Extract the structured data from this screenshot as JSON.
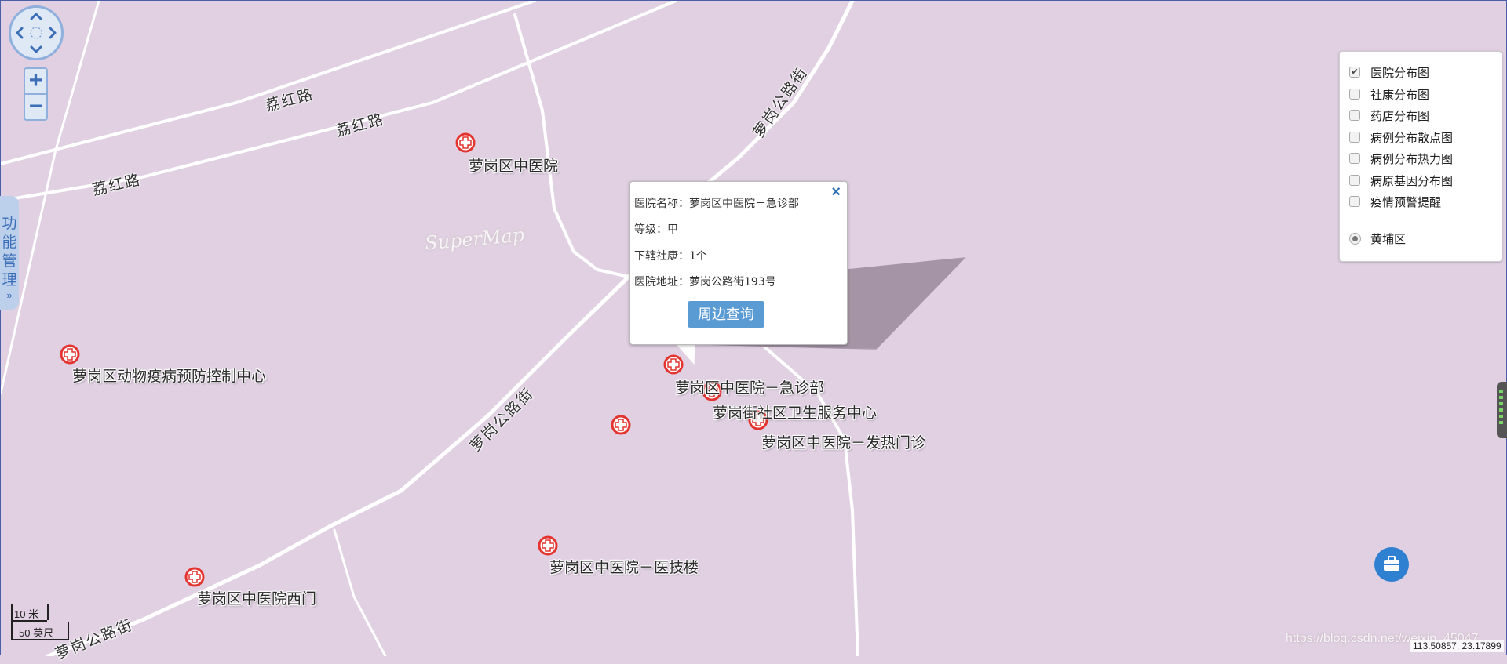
{
  "map": {
    "roads": [
      {
        "name": "荔红路"
      },
      {
        "name": "荔红路"
      },
      {
        "name": "荔红路"
      },
      {
        "name": "萝岗公路街"
      },
      {
        "name": "萝岗公路街"
      },
      {
        "name": "萝岗公路街"
      }
    ],
    "watermark": "SuperMap",
    "pois": [
      {
        "label": "萝岗区中医院"
      },
      {
        "label": "萝岗区动物疫病预防控制中心"
      },
      {
        "label": "萝岗区中医院－急诊部"
      },
      {
        "label": "萝岗街社区卫生服务中心"
      },
      {
        "label": "萝岗区中医院－发热门诊"
      },
      {
        "label": "萝岗区中医院－医技楼"
      },
      {
        "label": "萝岗区中医院西门"
      }
    ],
    "colors": {
      "background": "#e0d0e2",
      "road": "#ffffff",
      "hospital_icon": "#e4342f",
      "accent": "#2f80d1"
    }
  },
  "nav": {
    "pan_icon": "pan-compass-icon",
    "zoom_in": "+",
    "zoom_out": "−"
  },
  "side_tab": {
    "label": "功能管理",
    "arrow": "»"
  },
  "popup": {
    "close": "×",
    "rows": [
      {
        "label": "医院名称：",
        "value": "萝岗区中医院－急诊部"
      },
      {
        "label": "等级：",
        "value": "甲"
      },
      {
        "label": "下辖社康：",
        "value": "1个"
      },
      {
        "label": "医院地址：",
        "value": "萝岗公路街193号"
      }
    ],
    "button": "周边查询"
  },
  "layers": {
    "items": [
      {
        "label": "医院分布图",
        "checked": true
      },
      {
        "label": "社康分布图",
        "checked": false
      },
      {
        "label": "药店分布图",
        "checked": false
      },
      {
        "label": "病例分布散点图",
        "checked": false
      },
      {
        "label": "病例分布热力图",
        "checked": false
      },
      {
        "label": "病原基因分布图",
        "checked": false
      },
      {
        "label": "疫情预警提醒",
        "checked": false
      }
    ],
    "district": {
      "label": "黄埔区",
      "selected": true
    }
  },
  "scale": {
    "metric": "10 米",
    "imperial": "50 英尺"
  },
  "coordinates": "113.50857, 23.17899",
  "blog_watermark": "https://blog.csdn.net/weixin_45047"
}
